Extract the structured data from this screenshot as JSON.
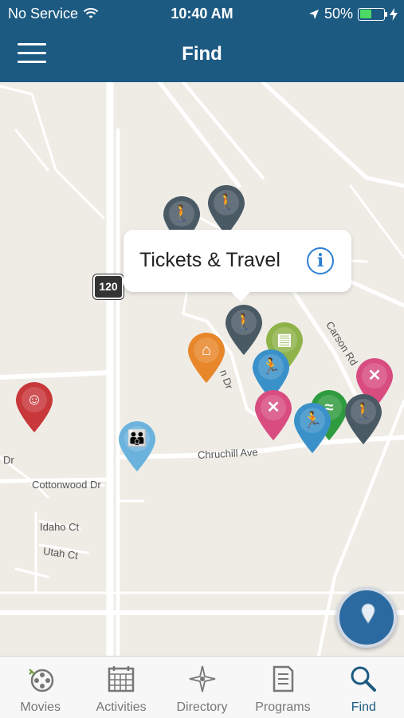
{
  "status_bar": {
    "carrier": "No Service",
    "time": "10:40 AM",
    "battery": "50%",
    "battery_level": 0.5
  },
  "nav": {
    "title": "Find"
  },
  "map": {
    "callout": {
      "title": "Tickets & Travel",
      "info": "i"
    },
    "route_shield": "120",
    "streets": {
      "churchill": "Chruchill Ave",
      "cottonwood": "Cottonwood Dr",
      "idaho": "Idaho Ct",
      "utah": "Utah Ct",
      "carson": "Carson Rd",
      "partial_dr": "n Dr",
      "left_dr": "Dr"
    },
    "pins": [
      {
        "category": "hiking",
        "color": "#4a5a64",
        "icon": "hiker-icon"
      },
      {
        "category": "hiking",
        "color": "#4a5a64",
        "icon": "hiker-icon"
      },
      {
        "category": "hiking",
        "color": "#4a5a64",
        "icon": "hiker-icon"
      },
      {
        "category": "tickets-travel",
        "color": "#8fb34a",
        "icon": "suitcase-icon"
      },
      {
        "category": "lodging",
        "color": "#e8862a",
        "icon": "house-icon"
      },
      {
        "category": "sports",
        "color": "#3a91c9",
        "icon": "runner-icon"
      },
      {
        "category": "dining",
        "color": "#d84c80",
        "icon": "fork-knife-icon"
      },
      {
        "category": "youth",
        "color": "#c8373a",
        "icon": "child-icon"
      },
      {
        "category": "family",
        "color": "#6bb3dc",
        "icon": "family-icon"
      },
      {
        "category": "dining",
        "color": "#d84c80",
        "icon": "fork-knife-icon"
      },
      {
        "category": "recreation",
        "color": "#2f9b3f",
        "icon": "swimmer-icon"
      },
      {
        "category": "sports",
        "color": "#3a91c9",
        "icon": "runner-icon"
      },
      {
        "category": "hiking",
        "color": "#4a5a64",
        "icon": "hiker-icon"
      }
    ]
  },
  "tabs": [
    {
      "label": "Movies",
      "icon": "film-reel-icon",
      "active": false
    },
    {
      "label": "Activities",
      "icon": "calendar-icon",
      "active": false
    },
    {
      "label": "Directory",
      "icon": "compass-icon",
      "active": false
    },
    {
      "label": "Programs",
      "icon": "document-icon",
      "active": false
    },
    {
      "label": "Find",
      "icon": "search-icon",
      "active": true
    }
  ],
  "colors": {
    "header": "#1c5a82",
    "accent": "#2a7fd4",
    "map_bg": "#efece6"
  }
}
